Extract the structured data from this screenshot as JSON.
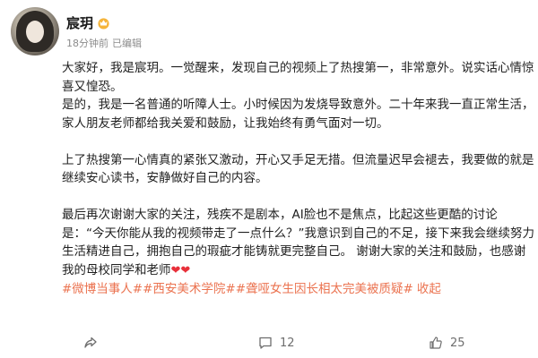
{
  "post": {
    "author": {
      "name": "宸玥",
      "badge_icon": "crown-icon",
      "time": "18分钟前",
      "edited": "已编辑"
    },
    "paragraphs": [
      "大家好，我是宸玥。一觉醒来，发现自己的视频上了热搜第一，非常意外。说实话心情惊喜又惶恐。",
      "是的，我是一名普通的听障人士。小时候因为发烧导致意外。二十年来我一直正常生活，家人朋友老师都给我关爱和鼓励，让我始终有勇气面对一切。",
      "",
      "上了热搜第一心情真的紧张又激动，开心又手足无措。但流量迟早会褪去，我要做的就是继续安心读书，安静做好自己的内容。",
      "",
      "最后再次谢谢大家的关注，残疾不是剧本，AI脸也不是焦点，比起这些更酷的讨论是：“今天你能从我的视频带走了一点什么？”我意识到自己的不足，接下来我会继续努力生活精进自己，拥抱自己的瑕疵才能铸就更完整自己。 谢谢大家的关注和鼓励，也感谢我的母校同学和老师"
    ],
    "hearts": "❤❤",
    "hashtags": [
      "#微博当事人#",
      "#西安美术学院#",
      "#聋哑女生因长相太完美被质疑#"
    ],
    "collapse_label": "收起"
  },
  "footer": {
    "share_icon": "share-icon",
    "comment_icon": "comment-icon",
    "comment_count": "12",
    "like_icon": "thumbs-up-icon",
    "like_count": "25"
  },
  "colors": {
    "accent": "#eb7350",
    "text": "#1f1f1f",
    "muted": "#8c8c8c",
    "heart": "#e8303a"
  }
}
